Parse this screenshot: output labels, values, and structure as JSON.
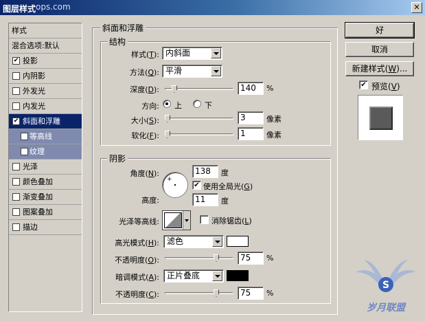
{
  "window": {
    "title": "图层样式",
    "title_overlap_text": "ops.com",
    "close_label": "✕"
  },
  "sidebar": {
    "header": "样式",
    "items": [
      {
        "label": "混合选项:默认",
        "checkbox": false,
        "checked": false
      },
      {
        "label": "投影",
        "checkbox": true,
        "checked": true
      },
      {
        "label": "内阴影",
        "checkbox": true,
        "checked": false
      },
      {
        "label": "外发光",
        "checkbox": true,
        "checked": false
      },
      {
        "label": "内发光",
        "checkbox": true,
        "checked": false
      },
      {
        "label": "斜面和浮雕",
        "checkbox": true,
        "checked": true,
        "selected": true
      },
      {
        "label": "等高线",
        "checkbox": true,
        "checked": false,
        "sub": true
      },
      {
        "label": "纹理",
        "checkbox": true,
        "checked": false,
        "sub": true
      },
      {
        "label": "光泽",
        "checkbox": true,
        "checked": false
      },
      {
        "label": "颜色叠加",
        "checkbox": true,
        "checked": false
      },
      {
        "label": "渐变叠加",
        "checkbox": true,
        "checked": false
      },
      {
        "label": "图案叠加",
        "checkbox": true,
        "checked": false
      },
      {
        "label": "描边",
        "checkbox": true,
        "checked": false
      }
    ]
  },
  "bevel": {
    "group_title": "斜面和浮雕",
    "structure_title": "结构",
    "style_label": "样式(T):",
    "style_label_pre": "样式(",
    "style_key": "T",
    "style_label_post": "):",
    "style_value": "内斜面",
    "technique_pre": "方法(",
    "technique_key": "Q",
    "technique_post": "):",
    "technique_value": "平滑",
    "depth_pre": "深度(",
    "depth_key": "D",
    "depth_post": "):",
    "depth_value": "140",
    "depth_unit": "%",
    "depth_slider": 0.14,
    "direction_label": "方向:",
    "direction_up": "上",
    "direction_down": "下",
    "size_pre": "大小(",
    "size_key": "S",
    "size_post": "):",
    "size_value": "3",
    "size_unit": "像素",
    "size_slider": 0.01,
    "soften_pre": "软化(",
    "soften_key": "F",
    "soften_post": "):",
    "soften_value": "1",
    "soften_unit": "像素",
    "soften_slider": 0.01
  },
  "shading": {
    "title": "阴影",
    "angle_pre": "角度(",
    "angle_key": "N",
    "angle_post": "):",
    "angle_value": "138",
    "angle_unit": "度",
    "global_light_pre": "使用全局光(",
    "global_light_key": "G",
    "global_light_post": ")",
    "global_light_checked": true,
    "altitude_label": "高度:",
    "altitude_value": "11",
    "altitude_unit": "度",
    "gloss_label": "光泽等高线:",
    "antialias_pre": "消除锯齿(",
    "antialias_key": "L",
    "antialias_post": ")",
    "antialias_checked": false,
    "highlight_mode_pre": "高光模式(",
    "highlight_mode_key": "H",
    "highlight_mode_post": "):",
    "highlight_mode_value": "滤色",
    "highlight_color": "#ffffff",
    "highlight_opacity_pre": "不透明度(",
    "highlight_opacity_key": "O",
    "highlight_opacity_post": "):",
    "highlight_opacity_value": "75",
    "highlight_opacity_unit": "%",
    "highlight_opacity_slider": 0.75,
    "shadow_mode_pre": "暗调模式(",
    "shadow_mode_key": "A",
    "shadow_mode_post": "):",
    "shadow_mode_value": "正片叠底",
    "shadow_color": "#000000",
    "shadow_opacity_pre": "不透明度(",
    "shadow_opacity_key": "C",
    "shadow_opacity_post": "):",
    "shadow_opacity_value": "75",
    "shadow_opacity_unit": "%",
    "shadow_opacity_slider": 0.75
  },
  "actions": {
    "ok": "好",
    "cancel": "取消",
    "new_style_pre": "新建样式(",
    "new_style_key": "W",
    "new_style_post": ")...",
    "preview_pre": "预览(",
    "preview_key": "V",
    "preview_post": ")",
    "preview_checked": true
  },
  "watermark": {
    "text": "岁月联盟",
    "letter": "S"
  },
  "colors": {
    "selection": "#0a246a",
    "sub_item": "#7f8aae",
    "dialog_bg": "#d4d0c8"
  }
}
